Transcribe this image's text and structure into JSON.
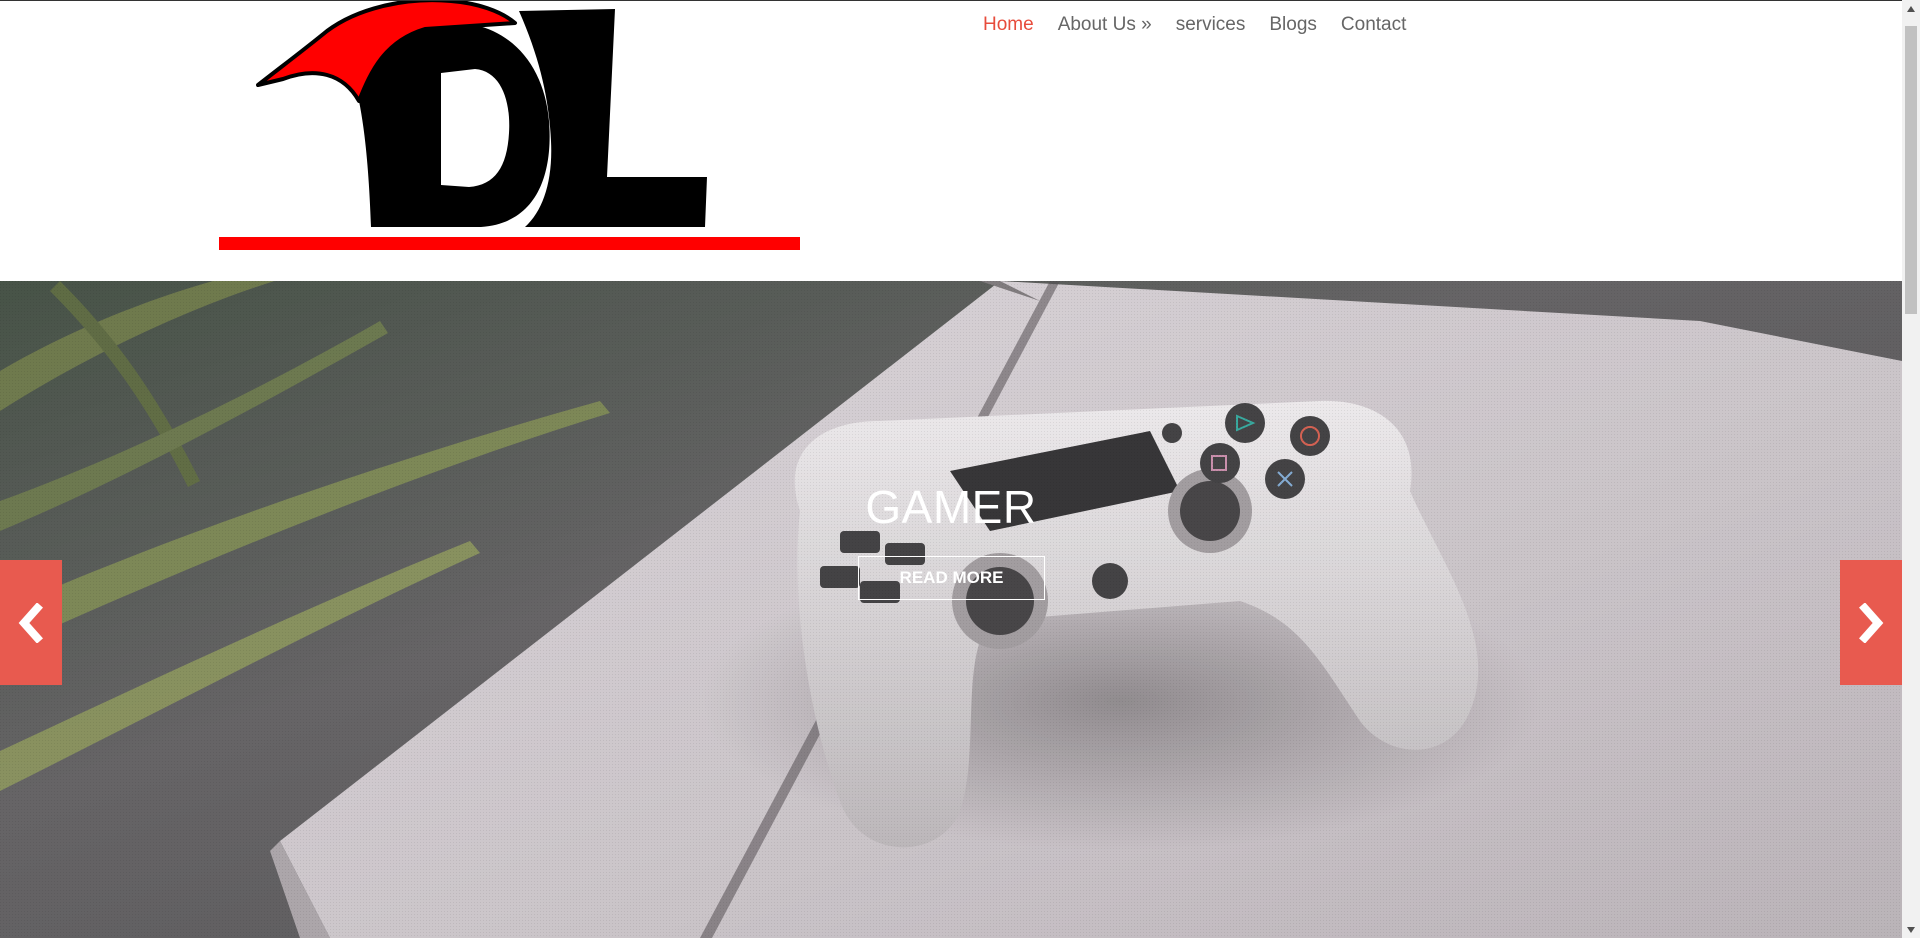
{
  "logo": {
    "letters": "DL",
    "colors": {
      "horn": "#ff0000",
      "letters": "#000000",
      "underline": "#ff0000"
    }
  },
  "nav": {
    "items": [
      {
        "label": "Home",
        "active": true
      },
      {
        "label": "About Us »",
        "active": false
      },
      {
        "label": "services",
        "active": false
      },
      {
        "label": "Blogs",
        "active": false
      },
      {
        "label": "Contact",
        "active": false
      }
    ],
    "colors": {
      "active": "#e74c3c",
      "default": "#666666"
    }
  },
  "hero": {
    "title": "GAMER",
    "button_label": "READ MORE",
    "prev_icon": "chevron-left-icon",
    "next_icon": "chevron-right-icon",
    "arrow_color": "#e85a4f"
  },
  "scrollbar": {
    "up_icon": "scroll-up-icon",
    "down_icon": "scroll-down-icon"
  }
}
